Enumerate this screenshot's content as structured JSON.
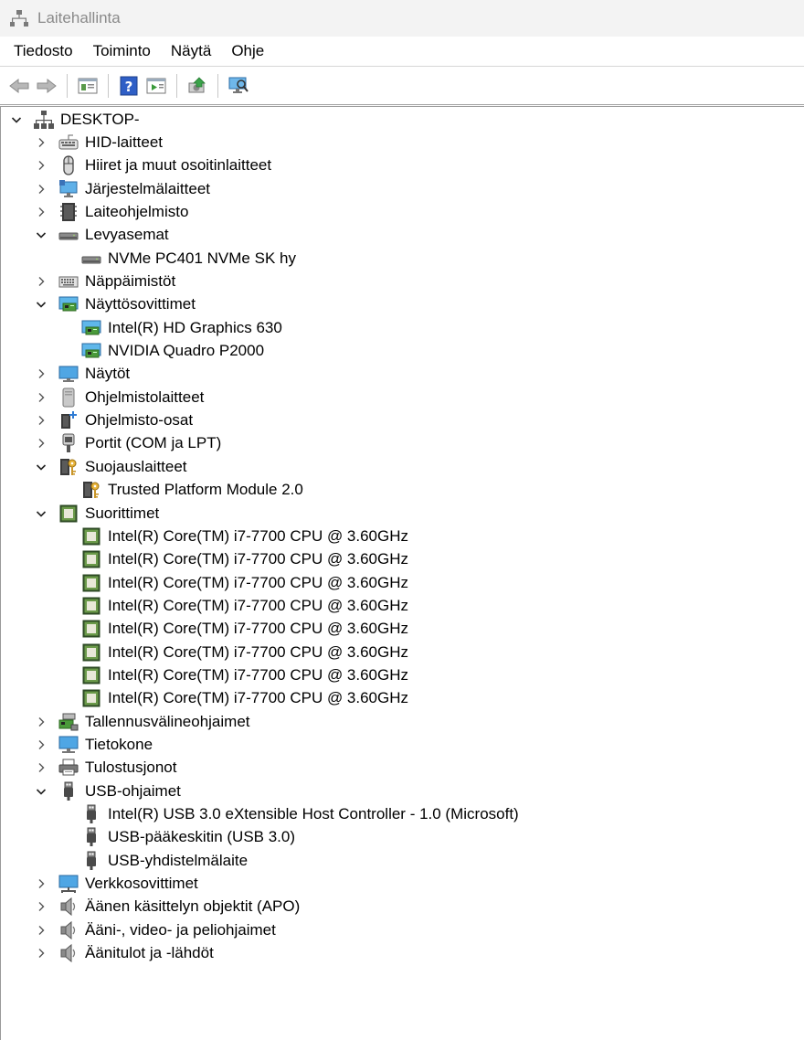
{
  "window": {
    "title": "Laitehallinta"
  },
  "menu": [
    "Tiedosto",
    "Toiminto",
    "Näytä",
    "Ohje"
  ],
  "toolbar": [
    {
      "name": "back-icon"
    },
    {
      "name": "forward-icon"
    },
    {
      "sep": true
    },
    {
      "name": "properties-icon"
    },
    {
      "sep": true
    },
    {
      "name": "help-icon"
    },
    {
      "name": "action-pane-icon"
    },
    {
      "sep": true
    },
    {
      "name": "update-driver-icon"
    },
    {
      "sep": true
    },
    {
      "name": "scan-hardware-icon"
    }
  ],
  "tree": [
    {
      "level": 0,
      "expanded": true,
      "icon": "computer-root",
      "label": "DESKTOP-"
    },
    {
      "level": 1,
      "expanded": false,
      "icon": "hid",
      "label": "HID-laitteet"
    },
    {
      "level": 1,
      "expanded": false,
      "icon": "mouse",
      "label": "Hiiret ja muut osoitinlaitteet"
    },
    {
      "level": 1,
      "expanded": false,
      "icon": "system",
      "label": "Järjestelmälaitteet"
    },
    {
      "level": 1,
      "expanded": false,
      "icon": "firmware",
      "label": "Laiteohjelmisto"
    },
    {
      "level": 1,
      "expanded": true,
      "icon": "disk",
      "label": "Levyasemat"
    },
    {
      "level": 2,
      "icon": "disk",
      "label": "NVMe PC401 NVMe SK hy"
    },
    {
      "level": 1,
      "expanded": false,
      "icon": "keyboard",
      "label": "Näppäimistöt"
    },
    {
      "level": 1,
      "expanded": true,
      "icon": "display-adapter",
      "label": "Näyttösovittimet"
    },
    {
      "level": 2,
      "icon": "display-adapter",
      "label": "Intel(R) HD Graphics 630"
    },
    {
      "level": 2,
      "icon": "display-adapter",
      "label": "NVIDIA Quadro P2000"
    },
    {
      "level": 1,
      "expanded": false,
      "icon": "monitor",
      "label": "Näytöt"
    },
    {
      "level": 1,
      "expanded": false,
      "icon": "software-device",
      "label": "Ohjelmistolaitteet"
    },
    {
      "level": 1,
      "expanded": false,
      "icon": "software-component",
      "label": "Ohjelmisto-osat"
    },
    {
      "level": 1,
      "expanded": false,
      "icon": "port",
      "label": "Portit (COM ja LPT)"
    },
    {
      "level": 1,
      "expanded": true,
      "icon": "security",
      "label": "Suojauslaitteet"
    },
    {
      "level": 2,
      "icon": "security",
      "label": "Trusted Platform Module 2.0"
    },
    {
      "level": 1,
      "expanded": true,
      "icon": "cpu",
      "label": "Suorittimet"
    },
    {
      "level": 2,
      "icon": "cpu",
      "label": "Intel(R) Core(TM) i7-7700 CPU @ 3.60GHz"
    },
    {
      "level": 2,
      "icon": "cpu",
      "label": "Intel(R) Core(TM) i7-7700 CPU @ 3.60GHz"
    },
    {
      "level": 2,
      "icon": "cpu",
      "label": "Intel(R) Core(TM) i7-7700 CPU @ 3.60GHz"
    },
    {
      "level": 2,
      "icon": "cpu",
      "label": "Intel(R) Core(TM) i7-7700 CPU @ 3.60GHz"
    },
    {
      "level": 2,
      "icon": "cpu",
      "label": "Intel(R) Core(TM) i7-7700 CPU @ 3.60GHz"
    },
    {
      "level": 2,
      "icon": "cpu",
      "label": "Intel(R) Core(TM) i7-7700 CPU @ 3.60GHz"
    },
    {
      "level": 2,
      "icon": "cpu",
      "label": "Intel(R) Core(TM) i7-7700 CPU @ 3.60GHz"
    },
    {
      "level": 2,
      "icon": "cpu",
      "label": "Intel(R) Core(TM) i7-7700 CPU @ 3.60GHz"
    },
    {
      "level": 1,
      "expanded": false,
      "icon": "storage-controller",
      "label": "Tallennusvälineohjaimet"
    },
    {
      "level": 1,
      "expanded": false,
      "icon": "computer",
      "label": "Tietokone"
    },
    {
      "level": 1,
      "expanded": false,
      "icon": "printer",
      "label": "Tulostusjonot"
    },
    {
      "level": 1,
      "expanded": true,
      "icon": "usb",
      "label": "USB-ohjaimet"
    },
    {
      "level": 2,
      "icon": "usb",
      "label": "Intel(R) USB 3.0 eXtensible Host Controller - 1.0 (Microsoft)"
    },
    {
      "level": 2,
      "icon": "usb",
      "label": "USB-pääkeskitin (USB 3.0)"
    },
    {
      "level": 2,
      "icon": "usb",
      "label": "USB-yhdistelmälaite"
    },
    {
      "level": 1,
      "expanded": false,
      "icon": "network",
      "label": "Verkkosovittimet"
    },
    {
      "level": 1,
      "expanded": false,
      "icon": "audio",
      "label": "Äänen käsittelyn objektit (APO)"
    },
    {
      "level": 1,
      "expanded": false,
      "icon": "audio",
      "label": "Ääni-, video- ja peliohjaimet"
    },
    {
      "level": 1,
      "expanded": false,
      "icon": "audio",
      "label": "Äänitulot ja -lähdöt"
    }
  ]
}
